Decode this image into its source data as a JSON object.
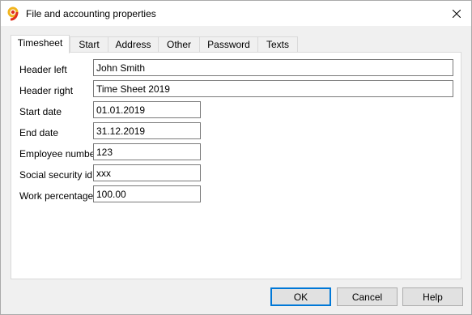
{
  "window": {
    "title": "File and accounting properties"
  },
  "tabs": [
    {
      "label": "Timesheet",
      "active": true
    },
    {
      "label": "Start",
      "active": false
    },
    {
      "label": "Address",
      "active": false
    },
    {
      "label": "Other",
      "active": false
    },
    {
      "label": "Password",
      "active": false
    },
    {
      "label": "Texts",
      "active": false
    }
  ],
  "form": {
    "header_left": {
      "label": "Header left",
      "value": "John Smith"
    },
    "header_right": {
      "label": "Header right",
      "value": "Time Sheet 2019"
    },
    "start_date": {
      "label": "Start date",
      "value": "01.01.2019"
    },
    "end_date": {
      "label": "End date",
      "value": "31.12.2019"
    },
    "employee_number": {
      "label": "Employee number",
      "value": "123"
    },
    "social_security_id": {
      "label": "Social security id",
      "value": "xxx"
    },
    "work_percentage": {
      "label": "Work percentage",
      "value": "100.00"
    }
  },
  "buttons": {
    "ok": "OK",
    "cancel": "Cancel",
    "help": "Help"
  },
  "icons": {
    "app": "app-logo-icon",
    "close": "close-icon"
  },
  "colors": {
    "app_icon_primary": "#e0301e",
    "app_icon_secondary": "#f2b51f",
    "default_button_border": "#0078d7"
  }
}
